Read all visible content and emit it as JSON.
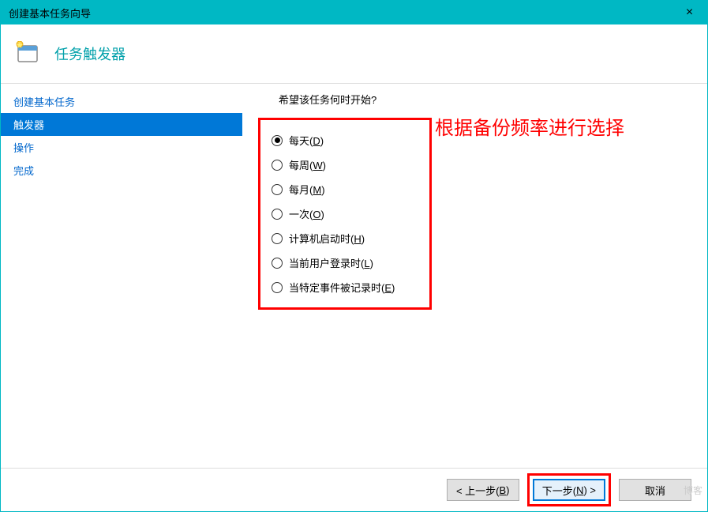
{
  "titlebar": {
    "text": "创建基本任务向导",
    "close": "×"
  },
  "header": {
    "title": "任务触发器"
  },
  "sidebar": {
    "items": [
      {
        "label": "创建基本任务"
      },
      {
        "label": "触发器"
      },
      {
        "label": "操作"
      },
      {
        "label": "完成"
      }
    ]
  },
  "main": {
    "prompt": "希望该任务何时开始?",
    "options": [
      {
        "label": "每天(",
        "hotkey": "D",
        "tail": ")",
        "selected": true
      },
      {
        "label": "每周(",
        "hotkey": "W",
        "tail": ")",
        "selected": false
      },
      {
        "label": "每月(",
        "hotkey": "M",
        "tail": ")",
        "selected": false
      },
      {
        "label": "一次(",
        "hotkey": "O",
        "tail": ")",
        "selected": false
      },
      {
        "label": "计算机启动时(",
        "hotkey": "H",
        "tail": ")",
        "selected": false
      },
      {
        "label": "当前用户登录时(",
        "hotkey": "L",
        "tail": ")",
        "selected": false
      },
      {
        "label": "当特定事件被记录时(",
        "hotkey": "E",
        "tail": ")",
        "selected": false
      }
    ],
    "annotation": "根据备份频率进行选择"
  },
  "footer": {
    "back": {
      "pre": "< 上一步(",
      "hotkey": "B",
      "tail": ")"
    },
    "next": {
      "pre": "下一步(",
      "hotkey": "N",
      "tail": ") >"
    },
    "cancel": "取消"
  },
  "watermark": "博客"
}
